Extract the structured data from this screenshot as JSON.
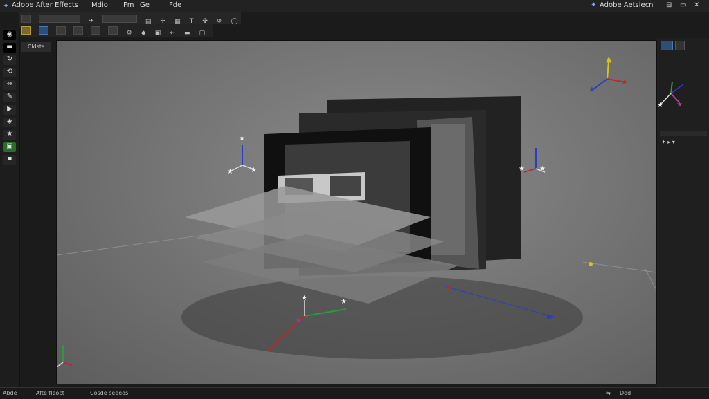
{
  "app": {
    "title": "Adobe After Effects",
    "menu": [
      "Mdio",
      "Fm",
      "Ge",
      "Fde"
    ],
    "right_title": "Adobe Aetsiecn"
  },
  "viewport": {
    "label": "Cldsts"
  },
  "status": {
    "left1": "Abde",
    "left2": "Afte fleoct",
    "left3": "Cosde seeeos",
    "right1": "Ded"
  },
  "colors": {
    "x_axis": "#c0262a",
    "y_axis": "#2a9a3a",
    "z_axis": "#2a3fc0",
    "accent": "#d9c21a",
    "panel": "#1f1f1f"
  },
  "icons": {
    "logo": "after-effects-star-icon",
    "axis_gizmo": "3d-axis-gizmo-icon",
    "light": "light-star-icon"
  }
}
